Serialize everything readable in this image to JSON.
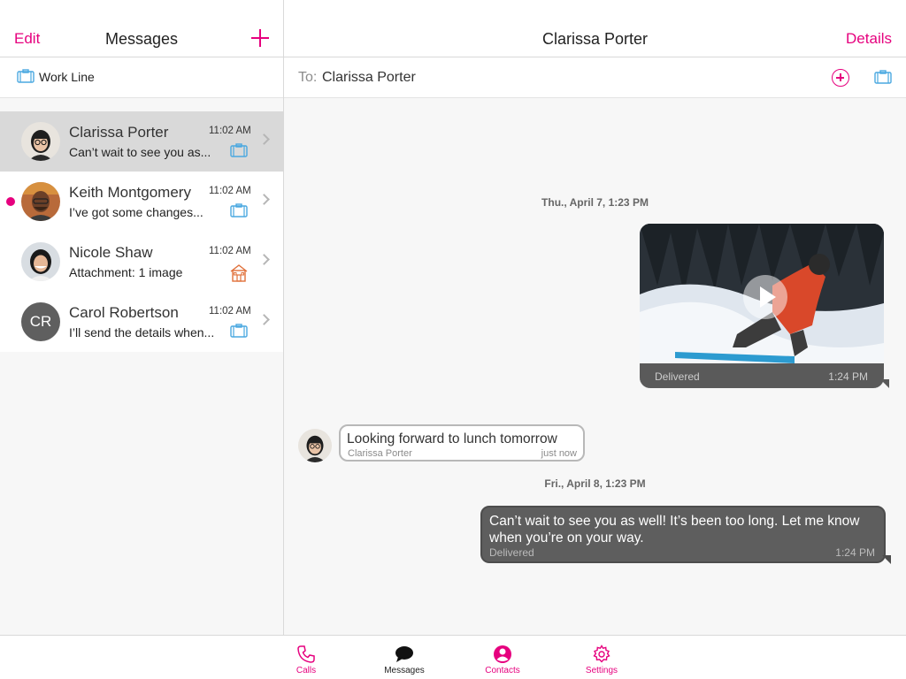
{
  "left_panel": {
    "edit_label": "Edit",
    "title": "Messages",
    "line_name": "Work Line",
    "conversations": [
      {
        "name": "Clarissa Porter",
        "time": "11:02 AM",
        "preview": "Can’t wait to see you as...",
        "selected": true,
        "unread": false,
        "line_icon": "briefcase-icon"
      },
      {
        "name": "Keith Montgomery",
        "time": "11:02 AM",
        "preview": "I’ve got some changes...",
        "selected": false,
        "unread": true,
        "line_icon": "briefcase-icon"
      },
      {
        "name": "Nicole Shaw",
        "time": "11:02 AM",
        "preview": "Attachment: 1 image",
        "selected": false,
        "unread": false,
        "line_icon": "home-icon"
      },
      {
        "name": "Carol Robertson",
        "time": "11:02 AM",
        "preview": "I’ll send the details when...",
        "selected": false,
        "unread": false,
        "line_icon": "briefcase-icon",
        "initials": "CR"
      }
    ]
  },
  "right_panel": {
    "contact_title": "Clarissa Porter",
    "details_label": "Details",
    "to_label": "To:",
    "to_value": "Clarissa Porter"
  },
  "thread": {
    "date_1": "Thu., April 7, 1:23 PM",
    "video_status": "Delivered",
    "video_time": "1:24 PM",
    "incoming_text": "Looking forward to lunch tomorrow",
    "incoming_sender": "Clarissa Porter",
    "incoming_time": "just now",
    "date_2": "Fri., April 8, 1:23 PM",
    "outgoing_text": "Can’t wait to see you as well! It’s been too long. Let me know when you’re on your way.",
    "outgoing_status": "Delivered",
    "outgoing_time": "1:24 PM"
  },
  "tabbar": {
    "tabs": [
      {
        "label": "Calls",
        "icon": "phone-icon"
      },
      {
        "label": "Messages",
        "icon": "chat-bubble-icon",
        "active": true
      },
      {
        "label": "Contacts",
        "icon": "contact-icon"
      },
      {
        "label": "Settings",
        "icon": "gear-icon"
      }
    ]
  },
  "colors": {
    "accent": "#e6007e",
    "line_icon_blue": "#4aa8e0",
    "home_icon_orange": "#e0703a",
    "selected_row": "#d9d9d9",
    "outgoing_bubble": "#5e5e5e"
  }
}
